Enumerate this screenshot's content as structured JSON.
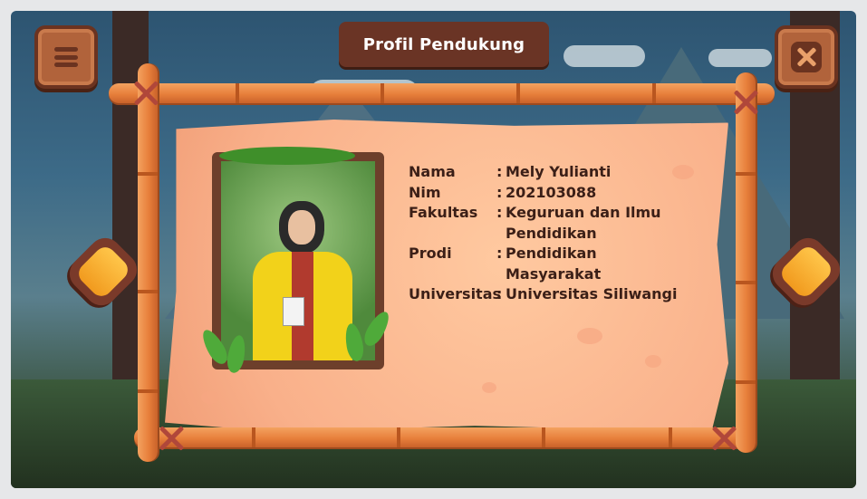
{
  "header": {
    "title": "Profil Pendukung"
  },
  "buttons": {
    "menu": "menu",
    "close": "close",
    "prev": "previous",
    "next": "next"
  },
  "profile": {
    "rows": [
      {
        "label": "Nama",
        "value": "Mely Yulianti"
      },
      {
        "label": "Nim",
        "value": "202103088"
      },
      {
        "label": "Fakultas",
        "value": "Keguruan dan Ilmu Pendidikan"
      },
      {
        "label": "Prodi",
        "value": "Pendidikan Masyarakat"
      },
      {
        "label": "Universitas",
        "value": "Universitas Siliwangi"
      }
    ],
    "separator": ":"
  },
  "icons": {
    "menu": "menu-icon",
    "close": "close-icon",
    "prev": "chevron-left-icon",
    "next": "chevron-right-icon"
  },
  "colors": {
    "title_bg": "#6a3425",
    "paper": "#f9b08a",
    "bamboo": "#e77f3b",
    "text": "#3b1f17",
    "arrow": "#f19a1e"
  }
}
